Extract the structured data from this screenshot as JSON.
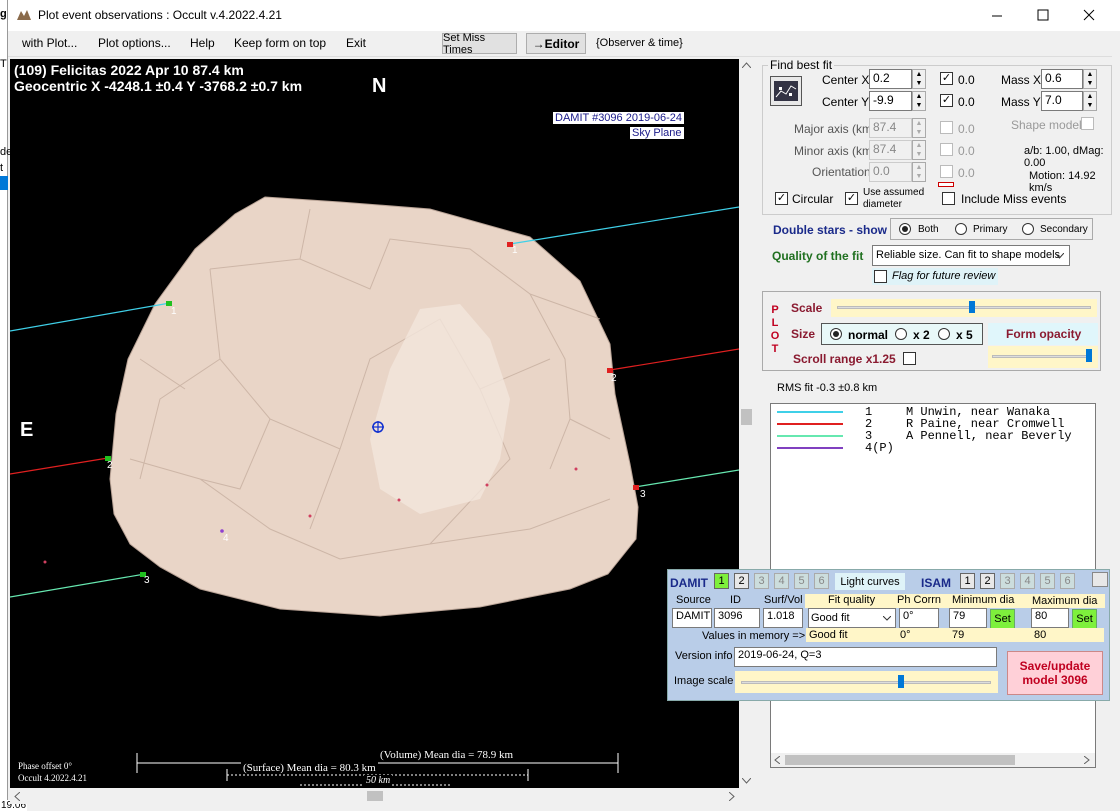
{
  "window": {
    "title": "Plot event observations : Occult v.4.2022.4.21",
    "minimize_icon": "minimize-icon",
    "maximize_icon": "maximize-icon",
    "close_icon": "close-icon"
  },
  "menu": {
    "with_plot": "with Plot...",
    "plot_options": "Plot options...",
    "help": "Help",
    "keep_on_top": "Keep form on top",
    "exit": "Exit",
    "set_miss_times": "Set Miss Times",
    "editor": "→Editor",
    "observer_time": "{Observer & time}"
  },
  "plot": {
    "header_line1": "(109) Felicitas  2022 Apr 10  87.4 km",
    "header_line2": "Geocentric X -4248.1 ±0.4  Y -3768.2 ±0.7 km",
    "north": "N",
    "east": "E",
    "damit_label1": "DAMIT #3096 2019-06-24",
    "damit_label2": "Sky Plane",
    "chord_labels": [
      "1",
      "2",
      "3",
      "1",
      "2",
      "3",
      "4"
    ],
    "volume_dia": "(Volume) Mean dia = 78.9 km",
    "surface_dia": "(Surface) Mean dia = 80.3 km",
    "scale_bar": "50 km",
    "phase_offset": "Phase offset 0°",
    "occult_version": "Occult 4.2022.4.21",
    "colors": {
      "chord1": "#3fd0e8",
      "chord2": "#e02020",
      "chord3": "#66e8b0",
      "shape": "#e8d4c6"
    }
  },
  "fit": {
    "section_title": "Find best fit",
    "center_x_label": "Center X",
    "center_x": "0.2",
    "center_y_label": "Center Y",
    "center_y": "-9.9",
    "cx_check_val": "0.0",
    "cy_check_val": "0.0",
    "mass_x_label": "Mass X",
    "mass_x": "0.6",
    "mass_y_label": "Mass Y",
    "mass_y": "7.0",
    "major_label": "Major axis (km)",
    "major": "87.4",
    "minor_label": "Minor axis (km)",
    "minor": "87.4",
    "orient_label": "Orientation",
    "orient": "0.0",
    "major_chk_val": "0.0",
    "minor_chk_val": "0.0",
    "orient_chk_val": "0.0",
    "shape_model": "Shape model",
    "ab_dmag": "a/b: 1.00, dMag: 0.00",
    "motion": "Motion: 14.92 km/s",
    "circular": "Circular",
    "use_assumed": "Use assumed",
    "diameter": "diameter",
    "include_miss": "Include Miss events",
    "double_stars": "Double stars - show",
    "both": "Both",
    "primary": "Primary",
    "secondary": "Secondary",
    "quality_label": "Quality of the fit",
    "quality_value": "Reliable size. Can fit to shape models",
    "flag_review": "Flag for future review"
  },
  "plotbox": {
    "plot_letters": [
      "P",
      "L",
      "O",
      "T"
    ],
    "scale": "Scale",
    "size": "Size",
    "normal": "normal",
    "x2": "x 2",
    "x5": "x 5",
    "form_opacity": "Form opacity",
    "scroll_range": "Scroll range x1.25"
  },
  "rms": "RMS fit -0.3 ±0.8 km",
  "legend": [
    {
      "num": "1",
      "text": "M Unwin, near Wanaka",
      "color": "#3fd0e8"
    },
    {
      "num": "2",
      "text": "R Paine, near Cromwell",
      "color": "#e02020"
    },
    {
      "num": "3",
      "text": "A Pennell, near Beverly",
      "color": "#66e8b0"
    },
    {
      "num": "4(P)",
      "text": "",
      "color": "#8040c0"
    }
  ],
  "damit": {
    "title": "DAMIT",
    "tabs": [
      "1",
      "2",
      "3",
      "4",
      "5",
      "6"
    ],
    "light_curves": "Light curves",
    "isam": "ISAM",
    "isam_tabs": [
      "1",
      "2",
      "3",
      "4",
      "5",
      "6"
    ],
    "source_hdr": "Source",
    "id_hdr": "ID",
    "surfvol_hdr": "Surf/Vol",
    "fitq_hdr": "Fit quality",
    "phcorr_hdr": "Ph Corrn",
    "mindia_hdr": "Minimum dia",
    "maxdia_hdr": "Maximum dia",
    "source": "DAMIT",
    "id": "3096",
    "surfvol": "1.018",
    "fitq": "Good fit",
    "phcorr": "0°",
    "mindia": "79",
    "maxdia": "80",
    "set": "Set",
    "values_mem": "Values in memory =>",
    "mem_fitq": "Good fit",
    "mem_phcorr": "0°",
    "mem_min": "79",
    "mem_max": "80",
    "version_label": "Version info",
    "version": "2019-06-24, Q=3",
    "image_scale": "Image scale",
    "save_update": "Save/update",
    "model": "model 3096"
  },
  "side_fragments": {
    "f1": "g",
    "f2": "T",
    "f3": "de",
    "f4": "t",
    "f5": "19.06"
  }
}
